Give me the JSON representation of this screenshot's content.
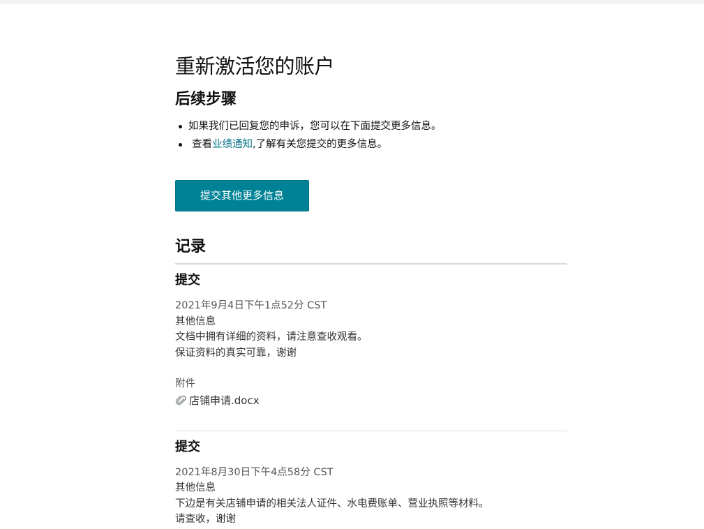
{
  "page": {
    "title": "重新激活您的账户",
    "next_steps_heading": "后续步骤",
    "steps": {
      "item1": "如果我们已回复您的申诉，您可以在下面提交更多信息。",
      "item2_prefix": "查看",
      "item2_link": "业绩通知",
      "item2_suffix": ",了解有关您提交的更多信息。"
    },
    "submit_button_label": "提交其他更多信息",
    "records_heading": "记录"
  },
  "records": [
    {
      "title": "提交",
      "date": "2021年9月4日下午1点52分 CST",
      "type": "其他信息",
      "lines": [
        "文档中拥有详细的资料，请注意查收观看。",
        "保证资料的真实可靠，谢谢"
      ],
      "attachments_label": "附件",
      "attachment_file": "店铺申请.docx",
      "attachment_icon": "paperclip-icon"
    },
    {
      "title": "提交",
      "date": "2021年8月30日下午4点58分 CST",
      "type": "其他信息",
      "lines": [
        "下边是有关店铺申请的相关法人证件、水电费账单、营业执照等材料。",
        "请查收，谢谢"
      ]
    }
  ],
  "colors": {
    "accent": "#008296",
    "link": "#007185",
    "divider": "#d5d9d9"
  }
}
